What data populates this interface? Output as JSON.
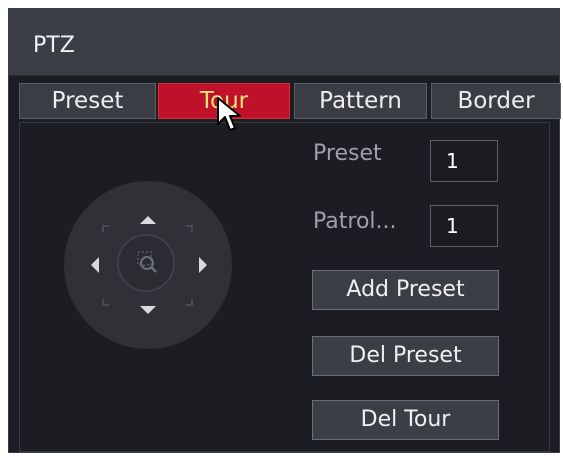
{
  "window": {
    "title": "PTZ"
  },
  "tabs": [
    {
      "label": "Preset",
      "active": false
    },
    {
      "label": "Tour",
      "active": true
    },
    {
      "label": "Pattern",
      "active": false
    },
    {
      "label": "Border",
      "active": false
    }
  ],
  "form": {
    "preset_label": "Preset",
    "preset_value": "1",
    "patrol_label": "Patrol...",
    "patrol_value": "1"
  },
  "buttons": {
    "add_preset": "Add Preset",
    "del_preset": "Del Preset",
    "del_tour": "Del Tour"
  },
  "joystick": {
    "icons": [
      "up-arrow-icon",
      "down-arrow-icon",
      "left-arrow-icon",
      "right-arrow-icon",
      "zoom-icon"
    ]
  },
  "colors": {
    "active_tab": "#c0112a",
    "active_tab_text": "#f1e27a",
    "panel_bg": "#1c1d22",
    "title_bar_bg": "#3b3e46"
  }
}
